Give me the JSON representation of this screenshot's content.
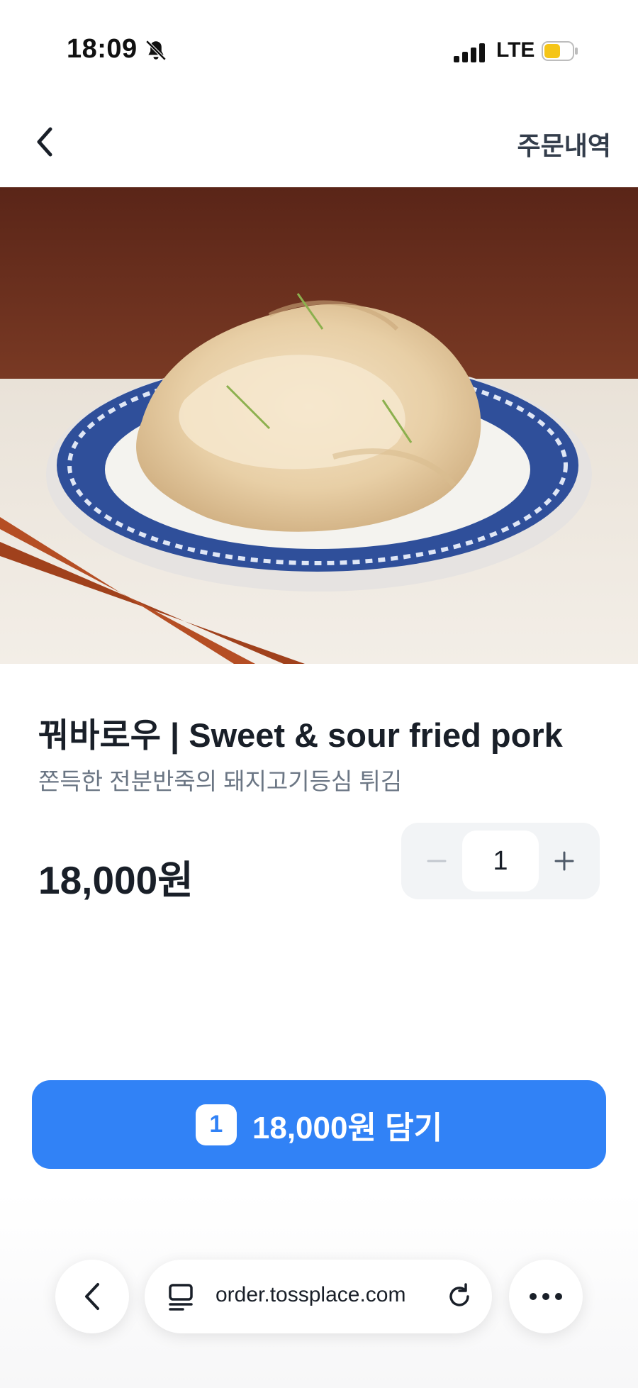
{
  "status_bar": {
    "time": "18:09",
    "network": "LTE",
    "icons": [
      "bell-slash-icon",
      "signal-icon",
      "battery-icon"
    ]
  },
  "nav": {
    "back_icon": "chevron-left-icon",
    "order_history_label": "주문내역"
  },
  "product": {
    "image_alt": "fried-pork-dish-photo",
    "title": "꿔바로우 | Sweet & sour fried pork",
    "description": "쫀득한 전분반죽의 돼지고기등심 튀김",
    "price": "18,000원",
    "quantity": "1"
  },
  "stepper": {
    "minus_icon": "minus-icon",
    "plus_icon": "plus-icon"
  },
  "cart_button": {
    "count": "1",
    "label": "18,000원 담기"
  },
  "browser_bar": {
    "url": "order.tossplace.com",
    "icons": [
      "chevron-left-icon",
      "tabs-icon",
      "reload-icon",
      "more-icon"
    ]
  },
  "colors": {
    "accent": "#3182f6",
    "text_primary": "#191f28",
    "text_secondary": "#6b7684",
    "stepper_bg": "#f2f4f6"
  }
}
